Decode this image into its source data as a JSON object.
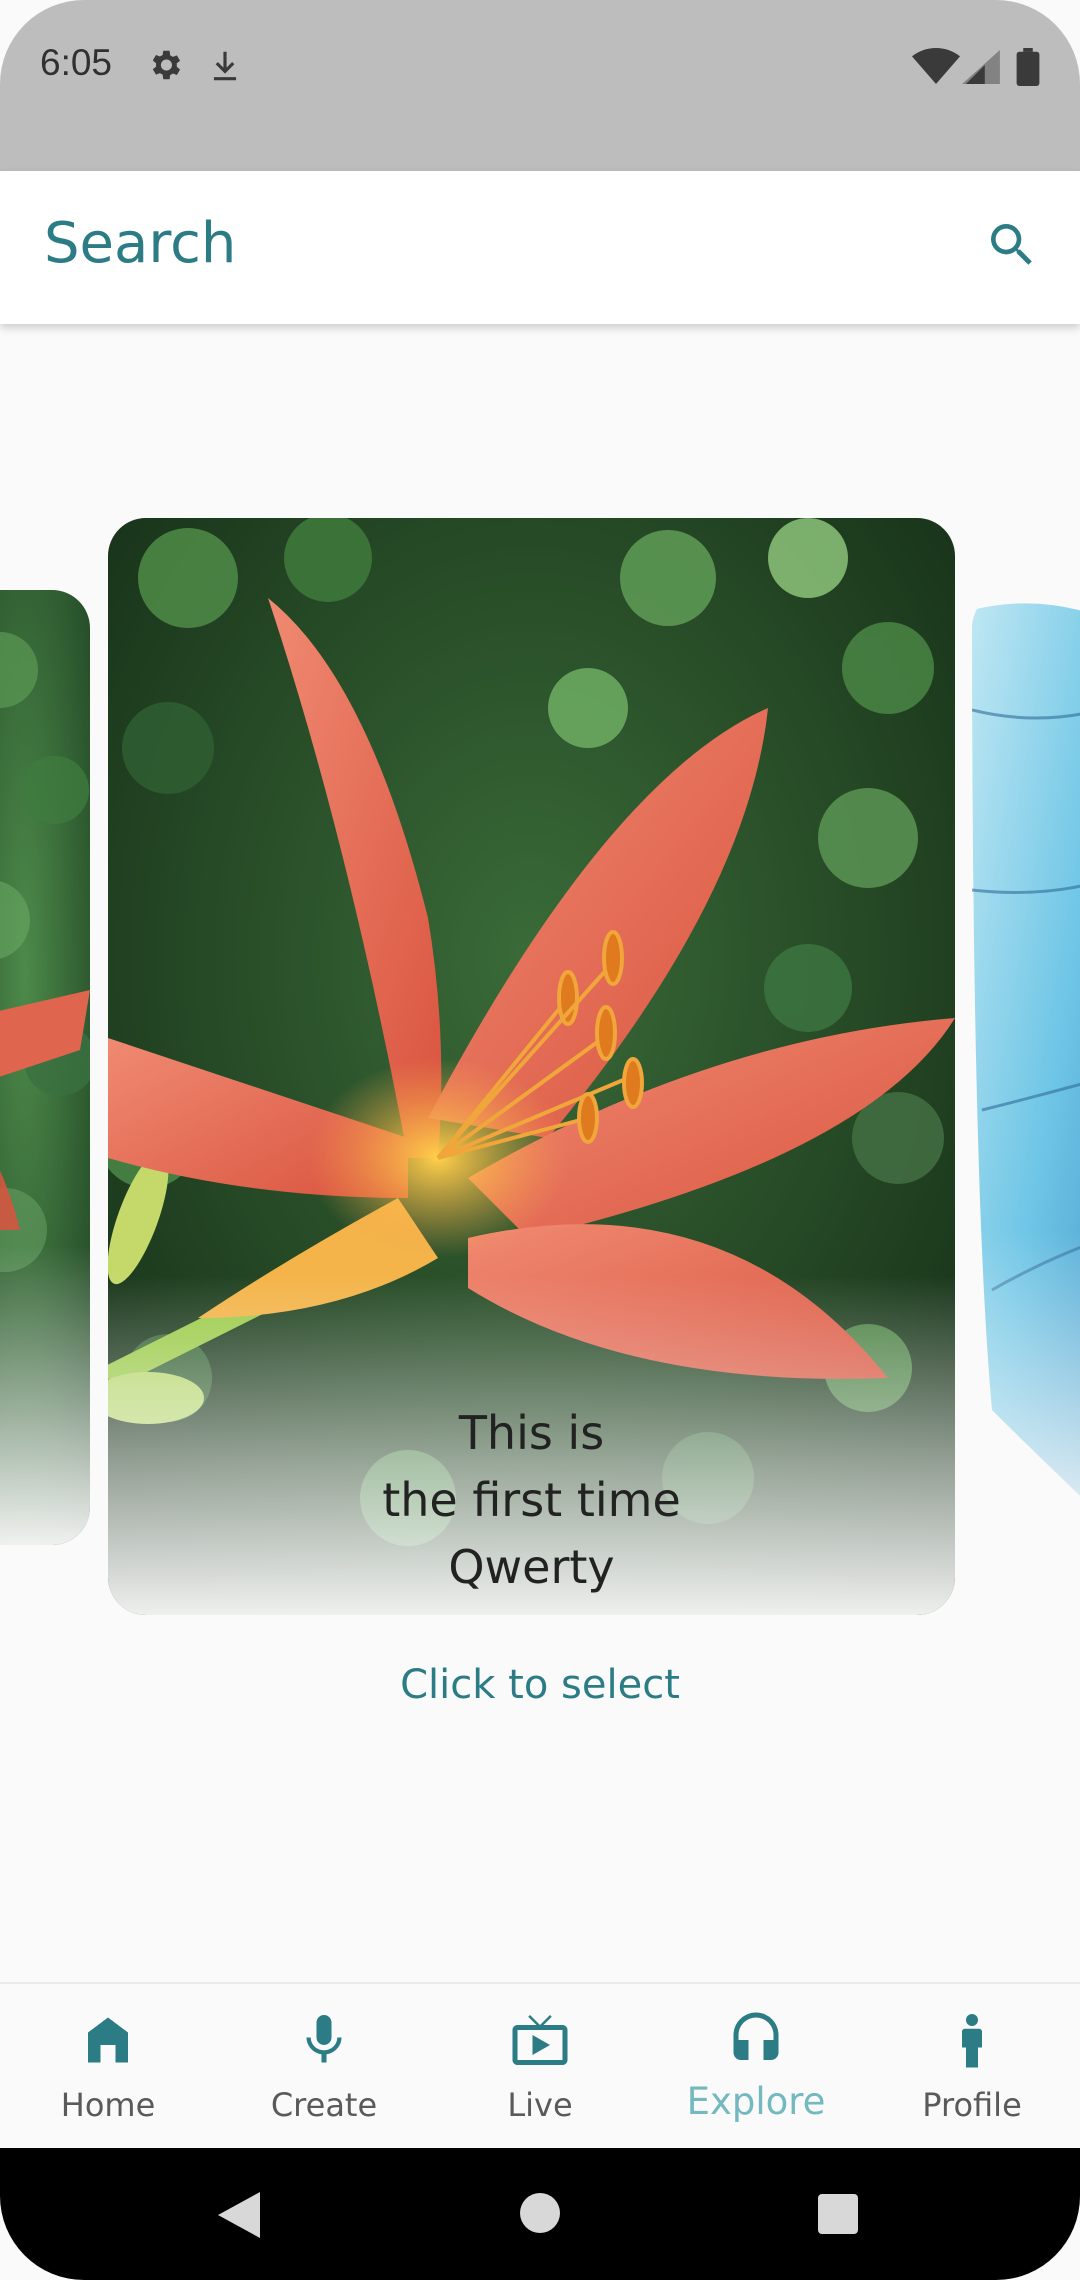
{
  "status_bar": {
    "time": "6:05",
    "icons": [
      "gear-icon",
      "download-icon",
      "wifi-icon",
      "signal-icon",
      "battery-icon"
    ]
  },
  "search": {
    "label": "Search",
    "icon": "search-icon"
  },
  "carousel": {
    "current_card": {
      "line1": "This is",
      "line2": "the first time",
      "line3": "Qwerty"
    },
    "prompt": "Click to select"
  },
  "bottom_nav": {
    "items": [
      {
        "label": "Home",
        "icon": "home-icon"
      },
      {
        "label": "Create",
        "icon": "microphone-icon"
      },
      {
        "label": "Live",
        "icon": "tv-icon"
      },
      {
        "label": "Explore",
        "icon": "headphones-icon",
        "active": true
      },
      {
        "label": "Profile",
        "icon": "person-icon"
      }
    ]
  },
  "colors": {
    "accent": "#2b7c85",
    "active_nav": "#73b9bf",
    "status_bar": "#bdbdbd"
  }
}
